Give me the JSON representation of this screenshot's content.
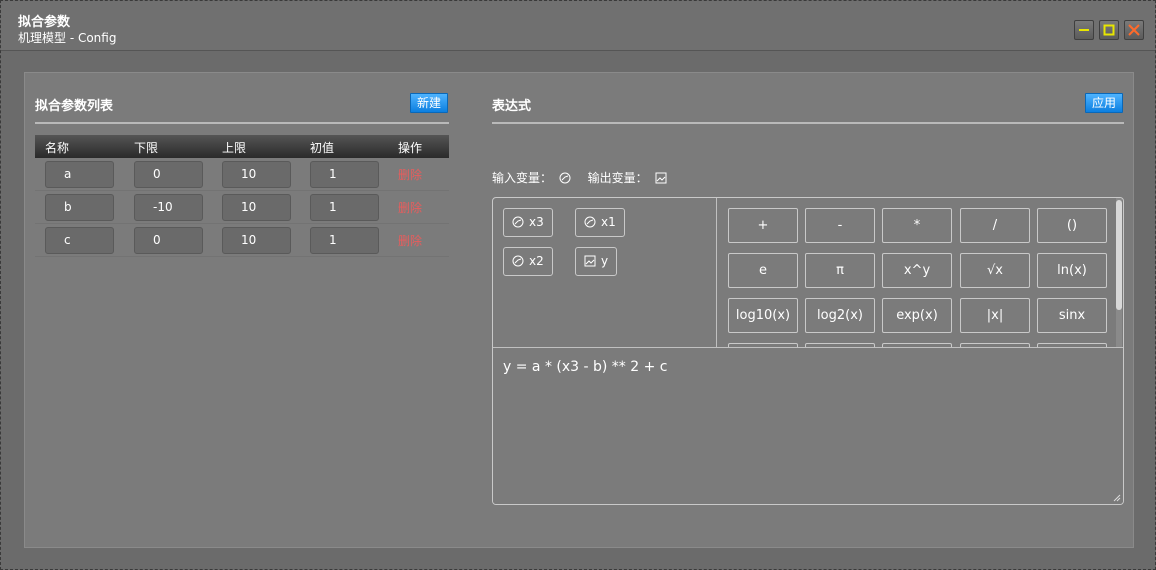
{
  "window": {
    "title": "拟合参数",
    "subtitle": "机理模型 - Config"
  },
  "left": {
    "title": "拟合参数列表",
    "new_button": "新建",
    "columns": [
      "名称",
      "下限",
      "上限",
      "初值",
      "操作"
    ],
    "rows": [
      {
        "name": "a",
        "lower": "0",
        "upper": "10",
        "init": "1",
        "action": "删除"
      },
      {
        "name": "b",
        "lower": "-10",
        "upper": "10",
        "init": "1",
        "action": "删除"
      },
      {
        "name": "c",
        "lower": "0",
        "upper": "10",
        "init": "1",
        "action": "删除"
      }
    ]
  },
  "right": {
    "title": "表达式",
    "apply_button": "应用",
    "input_var_label": "输入变量：",
    "output_var_label": "输出变量：",
    "variables": [
      "x3",
      "x1",
      "x2",
      "y"
    ],
    "operators": [
      "+",
      "-",
      "*",
      "/",
      "()",
      "e",
      "π",
      "x^y",
      "√x",
      "ln(x)",
      "log10(x)",
      "log2(x)",
      "exp(x)",
      "|x|",
      "sinx"
    ],
    "expression": "y = a * (x3 - b) ** 2 + c"
  },
  "icons": {
    "input": "gauge-icon",
    "output": "image-icon"
  },
  "colors": {
    "accent": "#0c7fe0",
    "delete": "#e85d5d"
  }
}
